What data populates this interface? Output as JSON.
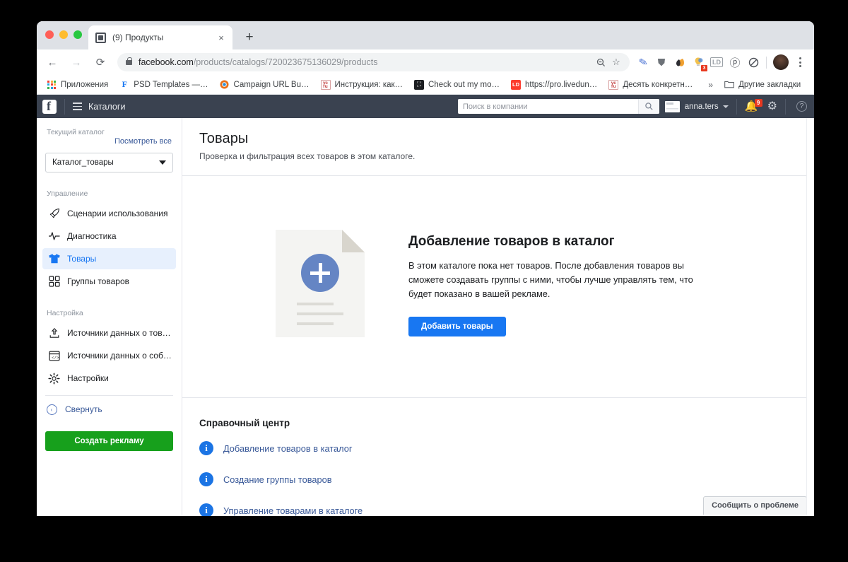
{
  "browser": {
    "tab": {
      "title": "(9) Продукты",
      "favicon": "image-icon",
      "close": "×"
    },
    "newtab_label": "+",
    "nav": {
      "back": "←",
      "forward": "→",
      "reload": "⟳"
    },
    "omnibox": {
      "url_domain": "facebook.com",
      "url_path": "/products/catalogs/720023675136029/products",
      "zoom_icon": "zoom-out-icon",
      "star_icon": "☆"
    },
    "extensions": [
      {
        "name": "pen-extension",
        "glyph": "✎",
        "color": "#4a72d4",
        "badge": ""
      },
      {
        "name": "shield-extension",
        "glyph": "⛨",
        "color": "#6d7278",
        "badge": ""
      },
      {
        "name": "honey-extension",
        "glyph": "◗",
        "color": "#f0a030",
        "badge": ""
      },
      {
        "name": "lightbulb-extension",
        "glyph": "💡",
        "color": "#f2c14e",
        "badge": "3"
      },
      {
        "name": "livedune-extension",
        "glyph": "LD",
        "color": "#9aa0a6",
        "badge": ""
      },
      {
        "name": "pinterest-extension",
        "glyph": "ⓟ",
        "color": "#4b4f56",
        "badge": ""
      },
      {
        "name": "adblock-extension",
        "glyph": "⃠",
        "color": "#4b4f56",
        "badge": ""
      }
    ],
    "profile_avatar": "user-avatar",
    "menu_icon": "kebab-menu-icon",
    "bookmarks": [
      {
        "label": "Приложения",
        "icon": "apps-grid-icon",
        "icon_glyph": "",
        "bg": ""
      },
      {
        "label": "PSD Templates —…",
        "icon": "facebook-icon",
        "icon_glyph": "F",
        "fg": "#1877f2"
      },
      {
        "label": "Campaign URL Bu…",
        "icon": "chrome-icon",
        "icon_glyph": "◉",
        "fg": "#e8701a"
      },
      {
        "label": "Инструкция: как…",
        "icon": "yc-ru-icon",
        "icon_glyph": "ус",
        "fg": "#c23b3b"
      },
      {
        "label": "Check out my mo…",
        "icon": "dark-square-icon",
        "icon_glyph": "⛶",
        "fg": "#ffffff",
        "bg": "#1c1e21"
      },
      {
        "label": "https://pro.livedun…",
        "icon": "livedune-icon",
        "icon_glyph": "LD",
        "fg": "#ffffff",
        "bg": "#fc3c2e"
      },
      {
        "label": "Десять конкретн…",
        "icon": "yc-ru-icon",
        "icon_glyph": "ус",
        "fg": "#c23b3b"
      }
    ],
    "bookmarks_overflow": "»",
    "other_bookmarks": {
      "label": "Другие закладки",
      "icon": "folder-icon",
      "icon_glyph": "🗀"
    }
  },
  "fbbar": {
    "logo": "facebook-logo",
    "menu_icon": "hamburger-icon",
    "title": "Каталоги",
    "search": {
      "placeholder": "Поиск в компании",
      "value": "",
      "button_icon": "search-icon"
    },
    "account": {
      "name": "anna.ters",
      "thumb": "business-thumbnail",
      "caret": "chevron-down-icon"
    },
    "notifications": {
      "icon": "bell-icon",
      "count": "9"
    },
    "settings_icon": "gear-icon",
    "help_icon": "question-mark-icon"
  },
  "sidebar": {
    "current_catalog_label": "Текущий каталог",
    "view_all_label": "Посмотреть все",
    "catalog_select": {
      "value": "Каталог_товары",
      "caret": "chevron-down-icon"
    },
    "groups": [
      {
        "label": "Управление",
        "items": [
          {
            "label": "Сценарии использования",
            "icon": "rocket-icon",
            "active": false
          },
          {
            "label": "Диагностика",
            "icon": "pulse-icon",
            "active": false
          },
          {
            "label": "Товары",
            "icon": "tshirt-icon",
            "active": true
          },
          {
            "label": "Группы товаров",
            "icon": "grid-icon",
            "active": false
          }
        ]
      },
      {
        "label": "Настройка",
        "items": [
          {
            "label": "Источники данных о тов…",
            "icon": "upload-icon",
            "active": false
          },
          {
            "label": "Источники данных о соб…",
            "icon": "code-window-icon",
            "active": false
          },
          {
            "label": "Настройки",
            "icon": "gear-icon",
            "active": false
          }
        ]
      }
    ],
    "collapse": {
      "label": "Свернуть",
      "icon": "chevron-left-circle-icon"
    },
    "cta_label": "Создать рекламу",
    "cta_color": "#17a01c"
  },
  "main": {
    "title": "Товары",
    "subtitle": "Проверка и фильтрация всех товаров в этом каталоге.",
    "empty_state": {
      "illustration": "document-plus-illustration",
      "heading": "Добавление товаров в каталог",
      "body": "В этом каталоге пока нет товаров. После добавления товаров вы сможете создавать группы с ними, чтобы лучше управлять тем, что будет показано в вашей рекламе.",
      "button_label": "Добавить товары",
      "button_color": "#1877f2"
    },
    "help_center": {
      "heading": "Справочный центр",
      "links": [
        {
          "label": "Добавление товаров в каталог",
          "icon": "info-icon"
        },
        {
          "label": "Создание группы товаров",
          "icon": "info-icon"
        },
        {
          "label": "Управление товарами в каталоге",
          "icon": "info-icon"
        }
      ]
    },
    "report_button": "Сообщить о проблеме"
  }
}
